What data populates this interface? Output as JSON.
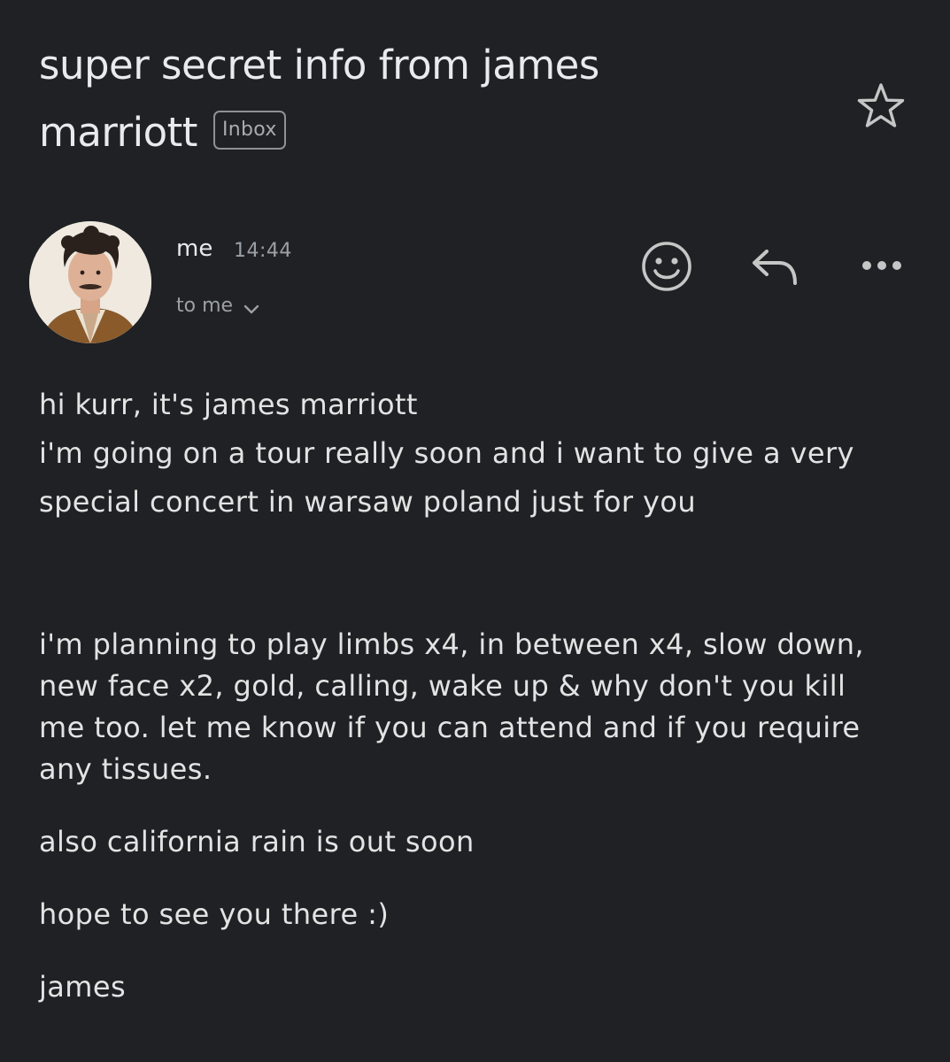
{
  "email": {
    "subject_line1": "super secret info from james",
    "subject_line2": "marriott",
    "label": "Inbox",
    "sender": "me",
    "time": "14:44",
    "recipients": "to me",
    "body": {
      "p1": [
        "hi kurr, it's james marriott",
        "i'm going on a tour really soon and i want to give a very",
        "special concert in warsaw poland just for you"
      ],
      "p2": [
        "i'm planning to play limbs x4, in between x4, slow down,",
        "new face x2, gold, calling, wake up & why don't you kill",
        "me too. let me know if you can attend and if you require",
        "any tissues."
      ],
      "p3": "also california rain is out soon",
      "p4": "hope to see you there :)",
      "p5": "james"
    }
  },
  "icons": {
    "star": "star-icon",
    "emoji": "add-reaction-icon",
    "reply": "reply-icon",
    "more": "more-icon",
    "chevron": "chevron-down-icon"
  },
  "colors": {
    "background": "#202124",
    "text": "#e3e3e3",
    "muted": "#9aa0a6"
  }
}
